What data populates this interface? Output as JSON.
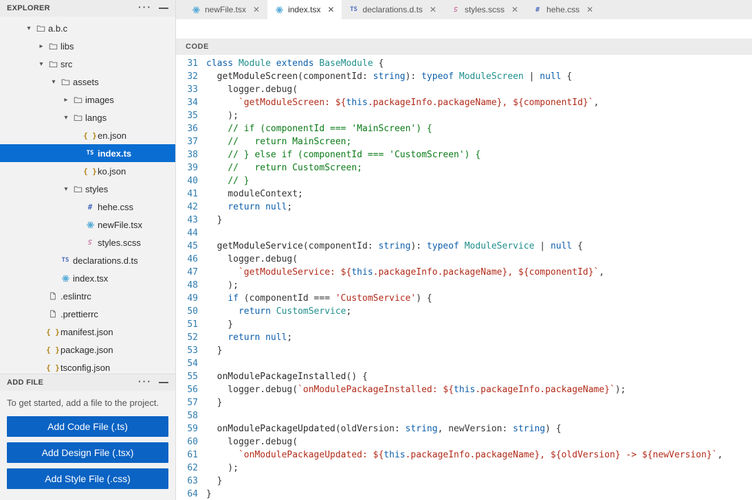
{
  "explorer": {
    "title": "EXPLORER",
    "tree": [
      {
        "depth": 0,
        "twisty": "down",
        "icon": "folder",
        "label": "a.b.c",
        "interactable": true
      },
      {
        "depth": 1,
        "twisty": "right",
        "icon": "folder",
        "label": "libs",
        "interactable": true
      },
      {
        "depth": 1,
        "twisty": "down",
        "icon": "folder",
        "label": "src",
        "interactable": true
      },
      {
        "depth": 2,
        "twisty": "down",
        "icon": "folder",
        "label": "assets",
        "interactable": true
      },
      {
        "depth": 3,
        "twisty": "right",
        "icon": "folder",
        "label": "images",
        "interactable": true
      },
      {
        "depth": 3,
        "twisty": "down",
        "icon": "folder",
        "label": "langs",
        "interactable": true
      },
      {
        "depth": 4,
        "twisty": "",
        "icon": "json",
        "label": "en.json",
        "interactable": true
      },
      {
        "depth": 4,
        "twisty": "",
        "icon": "ts",
        "label": "index.ts",
        "interactable": true,
        "selected": true
      },
      {
        "depth": 4,
        "twisty": "",
        "icon": "json",
        "label": "ko.json",
        "interactable": true
      },
      {
        "depth": 3,
        "twisty": "down",
        "icon": "folder",
        "label": "styles",
        "interactable": true
      },
      {
        "depth": 4,
        "twisty": "",
        "icon": "css",
        "label": "hehe.css",
        "interactable": true
      },
      {
        "depth": 4,
        "twisty": "",
        "icon": "react",
        "label": "newFile.tsx",
        "interactable": true
      },
      {
        "depth": 4,
        "twisty": "",
        "icon": "scss",
        "label": "styles.scss",
        "interactable": true
      },
      {
        "depth": 2,
        "twisty": "",
        "icon": "ts",
        "label": "declarations.d.ts",
        "interactable": true
      },
      {
        "depth": 2,
        "twisty": "",
        "icon": "react",
        "label": "index.tsx",
        "interactable": true
      },
      {
        "depth": 1,
        "twisty": "",
        "icon": "file",
        "label": ".eslintrc",
        "interactable": true
      },
      {
        "depth": 1,
        "twisty": "",
        "icon": "file",
        "label": ".prettierrc",
        "interactable": true
      },
      {
        "depth": 1,
        "twisty": "",
        "icon": "json",
        "label": "manifest.json",
        "interactable": true
      },
      {
        "depth": 1,
        "twisty": "",
        "icon": "json",
        "label": "package.json",
        "interactable": true
      },
      {
        "depth": 1,
        "twisty": "",
        "icon": "json",
        "label": "tsconfig.json",
        "interactable": true
      }
    ]
  },
  "addfile": {
    "title": "ADD FILE",
    "hint": "To get started, add a file to the project.",
    "buttons": [
      "Add Code File (.ts)",
      "Add Design File (.tsx)",
      "Add Style File (.css)"
    ]
  },
  "tabs": [
    {
      "icon": "react",
      "label": "newFile.tsx",
      "active": false
    },
    {
      "icon": "react",
      "label": "index.tsx",
      "active": true
    },
    {
      "icon": "ts",
      "label": "declarations.d.ts",
      "active": false
    },
    {
      "icon": "scss",
      "label": "styles.scss",
      "active": false
    },
    {
      "icon": "css",
      "label": "hehe.css",
      "active": false
    }
  ],
  "codeHeader": "CODE",
  "code": {
    "startLine": 31,
    "lines": [
      [
        [
          "kw",
          "class "
        ],
        [
          "tp",
          "Module"
        ],
        [
          "pn",
          " "
        ],
        [
          "kw",
          "extends"
        ],
        [
          "pn",
          " "
        ],
        [
          "tp",
          "BaseModule"
        ],
        [
          "pn",
          " {"
        ]
      ],
      [
        [
          "pn",
          "  "
        ],
        [
          "fn",
          "getModuleScreen"
        ],
        [
          "pn",
          "(componentId: "
        ],
        [
          "kw",
          "string"
        ],
        [
          "pn",
          "): "
        ],
        [
          "kw",
          "typeof"
        ],
        [
          "pn",
          " "
        ],
        [
          "tp",
          "ModuleScreen"
        ],
        [
          "pn",
          " | "
        ],
        [
          "kw",
          "null"
        ],
        [
          "pn",
          " {"
        ]
      ],
      [
        [
          "pn",
          "    logger.debug("
        ]
      ],
      [
        [
          "pn",
          "      "
        ],
        [
          "st",
          "`getModuleScreen: ${"
        ],
        [
          "kw",
          "this"
        ],
        [
          "st",
          ".packageInfo.packageName}, ${componentId}`"
        ],
        [
          "pn",
          ","
        ]
      ],
      [
        [
          "pn",
          "    );"
        ]
      ],
      [
        [
          "pn",
          "    "
        ],
        [
          "cm",
          "// if (componentId === 'MainScreen') {"
        ]
      ],
      [
        [
          "pn",
          "    "
        ],
        [
          "cm",
          "//   return MainScreen;"
        ]
      ],
      [
        [
          "pn",
          "    "
        ],
        [
          "cm",
          "// } else if (componentId === 'CustomScreen') {"
        ]
      ],
      [
        [
          "pn",
          "    "
        ],
        [
          "cm",
          "//   return CustomScreen;"
        ]
      ],
      [
        [
          "pn",
          "    "
        ],
        [
          "cm",
          "// }"
        ]
      ],
      [
        [
          "pn",
          "    moduleContext;"
        ]
      ],
      [
        [
          "pn",
          "    "
        ],
        [
          "kw",
          "return"
        ],
        [
          "pn",
          " "
        ],
        [
          "kw",
          "null"
        ],
        [
          "pn",
          ";"
        ]
      ],
      [
        [
          "pn",
          "  }"
        ]
      ],
      [
        [
          "pn",
          ""
        ]
      ],
      [
        [
          "pn",
          "  "
        ],
        [
          "fn",
          "getModuleService"
        ],
        [
          "pn",
          "(componentId: "
        ],
        [
          "kw",
          "string"
        ],
        [
          "pn",
          "): "
        ],
        [
          "kw",
          "typeof"
        ],
        [
          "pn",
          " "
        ],
        [
          "tp",
          "ModuleService"
        ],
        [
          "pn",
          " | "
        ],
        [
          "kw",
          "null"
        ],
        [
          "pn",
          " {"
        ]
      ],
      [
        [
          "pn",
          "    logger.debug("
        ]
      ],
      [
        [
          "pn",
          "      "
        ],
        [
          "st",
          "`getModuleService: ${"
        ],
        [
          "kw",
          "this"
        ],
        [
          "st",
          ".packageInfo.packageName}, ${componentId}`"
        ],
        [
          "pn",
          ","
        ]
      ],
      [
        [
          "pn",
          "    );"
        ]
      ],
      [
        [
          "pn",
          "    "
        ],
        [
          "kw",
          "if"
        ],
        [
          "pn",
          " (componentId === "
        ],
        [
          "st",
          "'CustomService'"
        ],
        [
          "pn",
          ") {"
        ]
      ],
      [
        [
          "pn",
          "      "
        ],
        [
          "kw",
          "return"
        ],
        [
          "pn",
          " "
        ],
        [
          "tp",
          "CustomService"
        ],
        [
          "pn",
          ";"
        ]
      ],
      [
        [
          "pn",
          "    }"
        ]
      ],
      [
        [
          "pn",
          "    "
        ],
        [
          "kw",
          "return"
        ],
        [
          "pn",
          " "
        ],
        [
          "kw",
          "null"
        ],
        [
          "pn",
          ";"
        ]
      ],
      [
        [
          "pn",
          "  }"
        ]
      ],
      [
        [
          "pn",
          ""
        ]
      ],
      [
        [
          "pn",
          "  "
        ],
        [
          "fn",
          "onModulePackageInstalled"
        ],
        [
          "pn",
          "() {"
        ]
      ],
      [
        [
          "pn",
          "    logger.debug("
        ],
        [
          "st",
          "`onModulePackageInstalled: ${"
        ],
        [
          "kw",
          "this"
        ],
        [
          "st",
          ".packageInfo.packageName}`"
        ],
        [
          "pn",
          ");"
        ]
      ],
      [
        [
          "pn",
          "  }"
        ]
      ],
      [
        [
          "pn",
          ""
        ]
      ],
      [
        [
          "pn",
          "  "
        ],
        [
          "fn",
          "onModulePackageUpdated"
        ],
        [
          "pn",
          "(oldVersion: "
        ],
        [
          "kw",
          "string"
        ],
        [
          "pn",
          ", newVersion: "
        ],
        [
          "kw",
          "string"
        ],
        [
          "pn",
          ") {"
        ]
      ],
      [
        [
          "pn",
          "    logger.debug("
        ]
      ],
      [
        [
          "pn",
          "      "
        ],
        [
          "st",
          "`onModulePackageUpdated: ${"
        ],
        [
          "kw",
          "this"
        ],
        [
          "st",
          ".packageInfo.packageName}, ${oldVersion} -> ${newVersion}`"
        ],
        [
          "pn",
          ","
        ]
      ],
      [
        [
          "pn",
          "    );"
        ]
      ],
      [
        [
          "pn",
          "  }"
        ]
      ],
      [
        [
          "pn",
          "}"
        ]
      ]
    ]
  }
}
